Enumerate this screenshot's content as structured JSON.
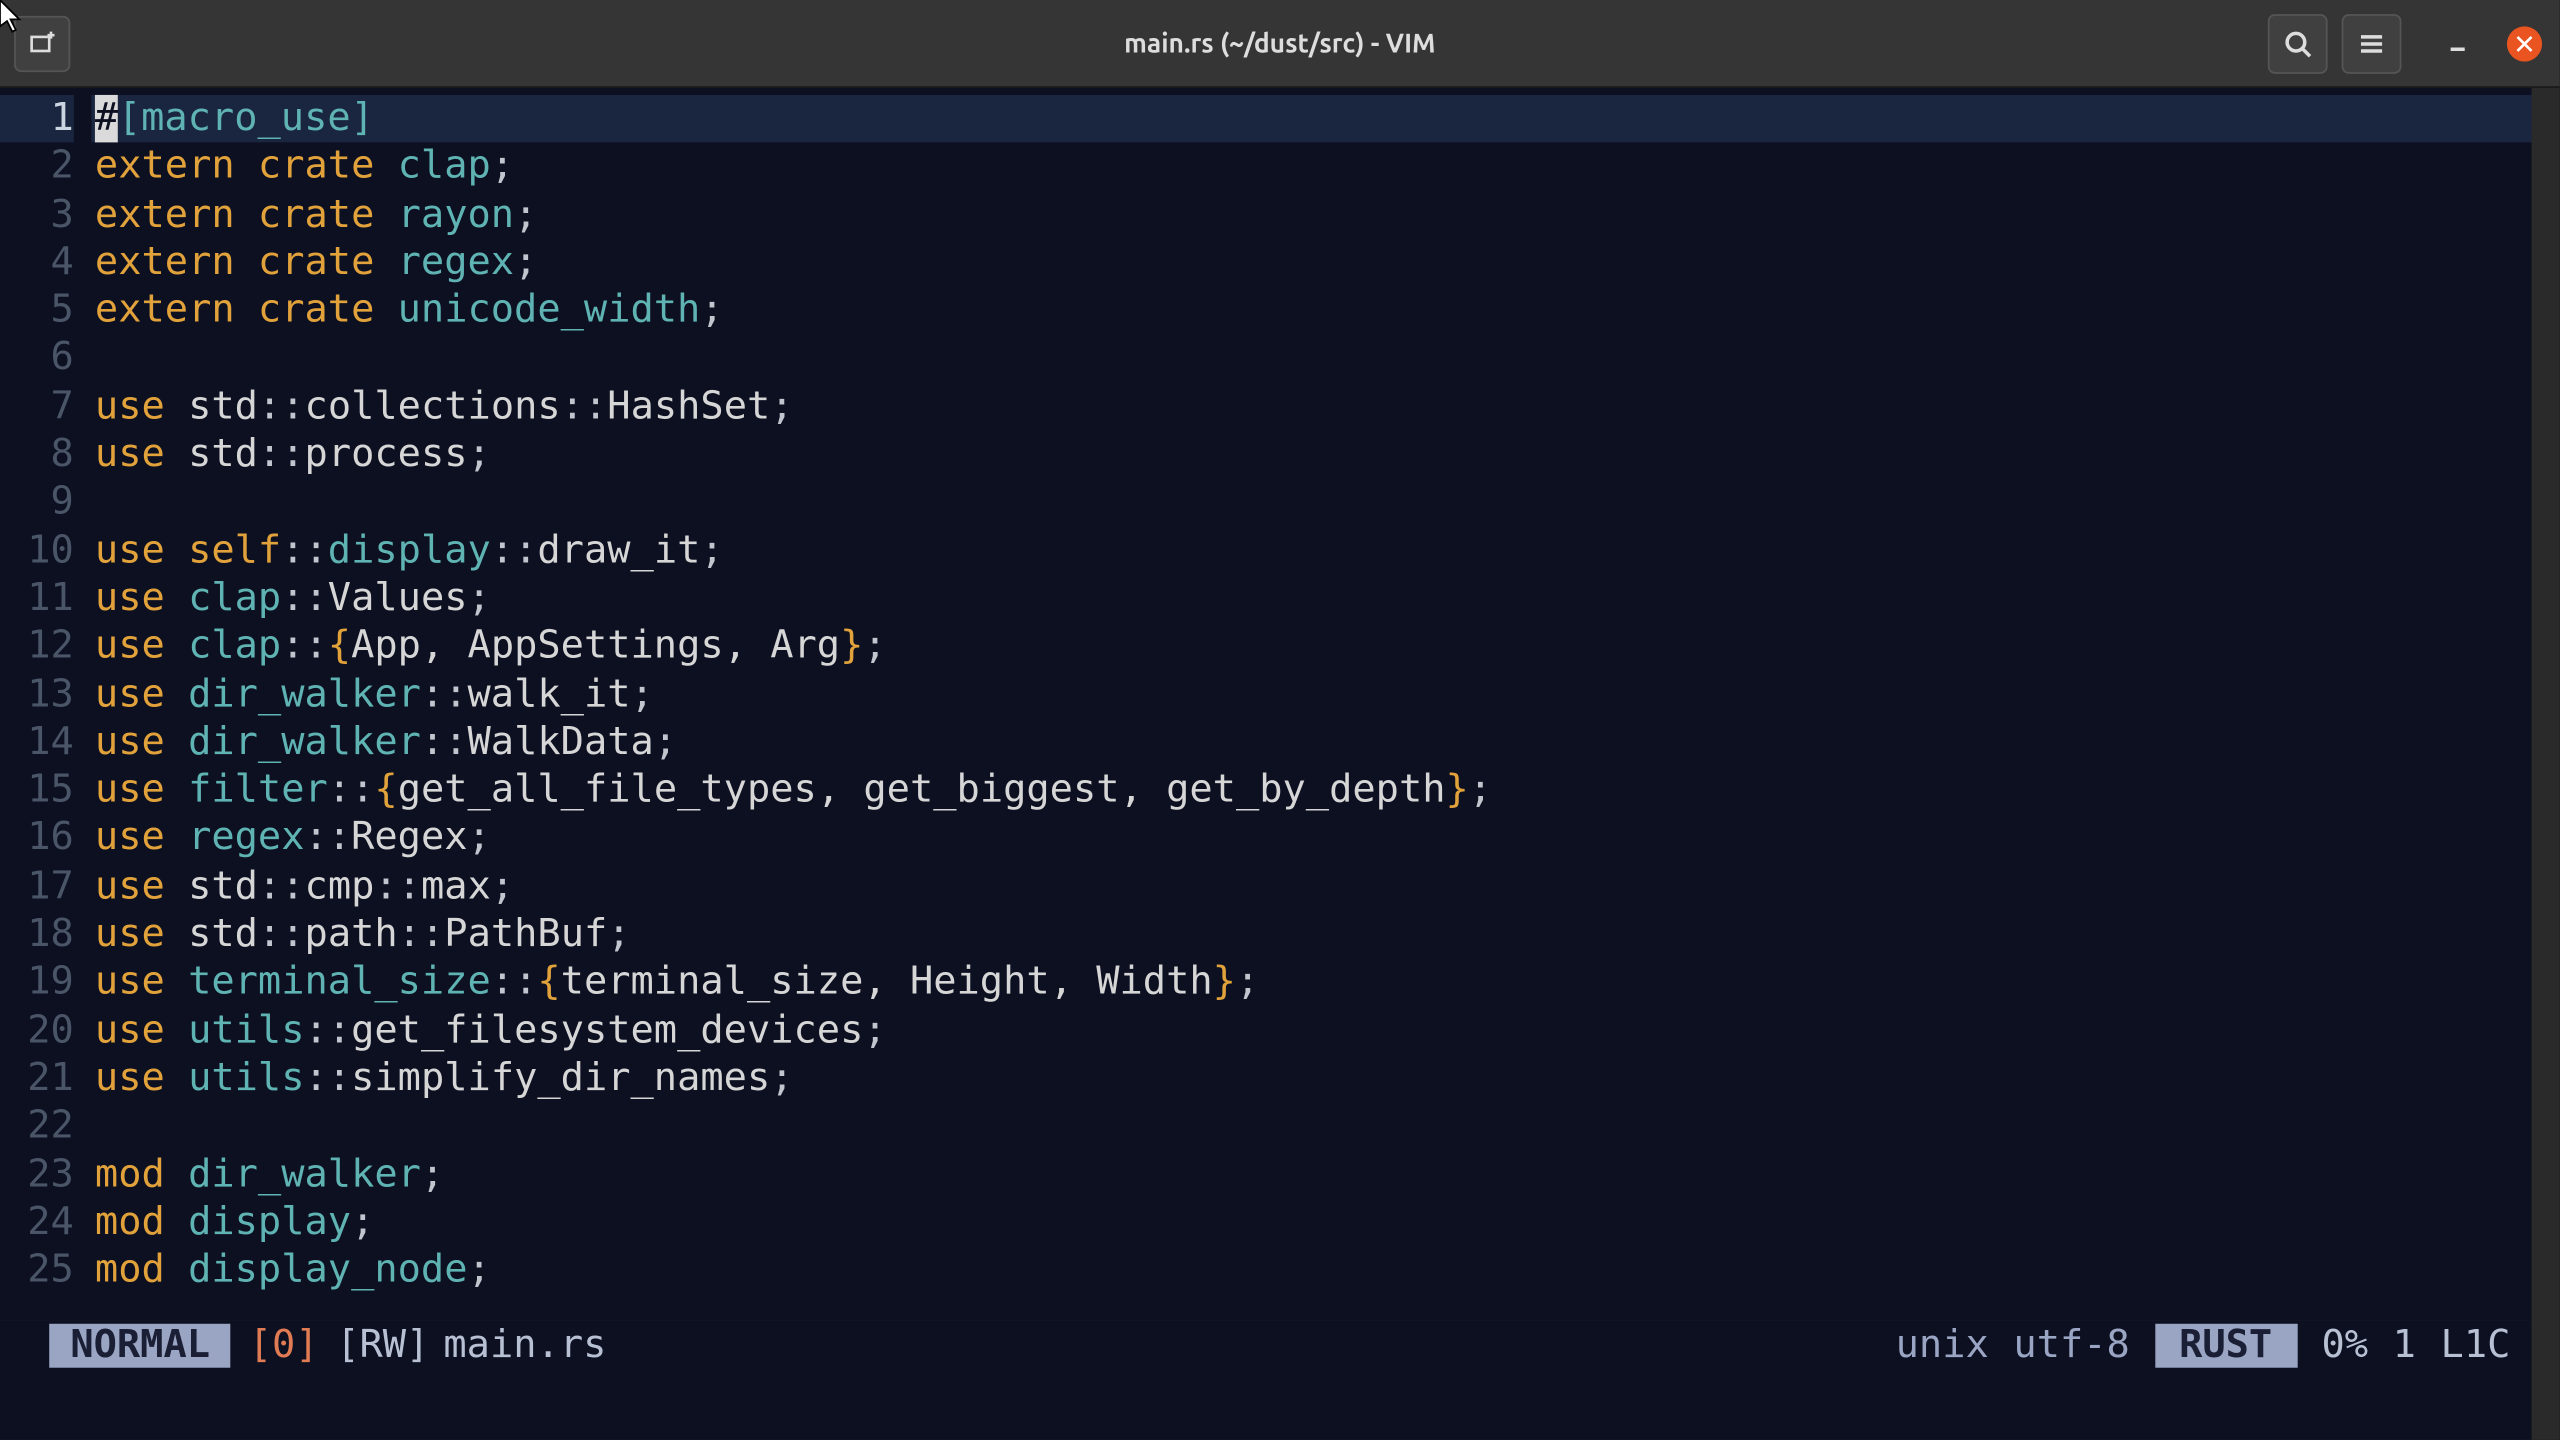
{
  "window": {
    "title": "main.rs (~/dust/src) - VIM"
  },
  "code": {
    "lines": [
      {
        "n": 1,
        "current": true,
        "tokens": [
          {
            "t": "#",
            "cursor": true
          },
          {
            "t": "[macro_use]",
            "c": "kw-teal"
          }
        ]
      },
      {
        "n": 2,
        "tokens": [
          {
            "t": "extern crate ",
            "c": "kw-orange"
          },
          {
            "t": "clap",
            "c": "kw-teal"
          },
          {
            "t": ";",
            "c": "punct"
          }
        ]
      },
      {
        "n": 3,
        "tokens": [
          {
            "t": "extern crate ",
            "c": "kw-orange"
          },
          {
            "t": "rayon",
            "c": "kw-teal"
          },
          {
            "t": ";",
            "c": "punct"
          }
        ]
      },
      {
        "n": 4,
        "tokens": [
          {
            "t": "extern crate ",
            "c": "kw-orange"
          },
          {
            "t": "regex",
            "c": "kw-teal"
          },
          {
            "t": ";",
            "c": "punct"
          }
        ]
      },
      {
        "n": 5,
        "tokens": [
          {
            "t": "extern crate ",
            "c": "kw-orange"
          },
          {
            "t": "unicode_width",
            "c": "kw-teal"
          },
          {
            "t": ";",
            "c": "punct"
          }
        ]
      },
      {
        "n": 6,
        "tokens": []
      },
      {
        "n": 7,
        "tokens": [
          {
            "t": "use ",
            "c": "kw-orange"
          },
          {
            "t": "std",
            "c": "ident"
          },
          {
            "t": "::",
            "c": "punct"
          },
          {
            "t": "collections",
            "c": "ident"
          },
          {
            "t": "::",
            "c": "punct"
          },
          {
            "t": "HashSet",
            "c": "ident"
          },
          {
            "t": ";",
            "c": "punct"
          }
        ]
      },
      {
        "n": 8,
        "tokens": [
          {
            "t": "use ",
            "c": "kw-orange"
          },
          {
            "t": "std",
            "c": "ident"
          },
          {
            "t": "::",
            "c": "punct"
          },
          {
            "t": "process",
            "c": "ident"
          },
          {
            "t": ";",
            "c": "punct"
          }
        ]
      },
      {
        "n": 9,
        "tokens": []
      },
      {
        "n": 10,
        "tokens": [
          {
            "t": "use ",
            "c": "kw-orange"
          },
          {
            "t": "self",
            "c": "kw-orange"
          },
          {
            "t": "::",
            "c": "punct"
          },
          {
            "t": "display",
            "c": "kw-teal"
          },
          {
            "t": "::",
            "c": "punct"
          },
          {
            "t": "draw_it",
            "c": "ident"
          },
          {
            "t": ";",
            "c": "punct"
          }
        ]
      },
      {
        "n": 11,
        "tokens": [
          {
            "t": "use ",
            "c": "kw-orange"
          },
          {
            "t": "clap",
            "c": "kw-teal"
          },
          {
            "t": "::",
            "c": "punct"
          },
          {
            "t": "Values",
            "c": "ident"
          },
          {
            "t": ";",
            "c": "punct"
          }
        ]
      },
      {
        "n": 12,
        "tokens": [
          {
            "t": "use ",
            "c": "kw-orange"
          },
          {
            "t": "clap",
            "c": "kw-teal"
          },
          {
            "t": "::",
            "c": "punct"
          },
          {
            "t": "{",
            "c": "brace"
          },
          {
            "t": "App, AppSettings, Arg",
            "c": "ident"
          },
          {
            "t": "}",
            "c": "brace"
          },
          {
            "t": ";",
            "c": "punct"
          }
        ]
      },
      {
        "n": 13,
        "tokens": [
          {
            "t": "use ",
            "c": "kw-orange"
          },
          {
            "t": "dir_walker",
            "c": "kw-teal"
          },
          {
            "t": "::",
            "c": "punct"
          },
          {
            "t": "walk_it",
            "c": "ident"
          },
          {
            "t": ";",
            "c": "punct"
          }
        ]
      },
      {
        "n": 14,
        "tokens": [
          {
            "t": "use ",
            "c": "kw-orange"
          },
          {
            "t": "dir_walker",
            "c": "kw-teal"
          },
          {
            "t": "::",
            "c": "punct"
          },
          {
            "t": "WalkData",
            "c": "ident"
          },
          {
            "t": ";",
            "c": "punct"
          }
        ]
      },
      {
        "n": 15,
        "tokens": [
          {
            "t": "use ",
            "c": "kw-orange"
          },
          {
            "t": "filter",
            "c": "kw-teal"
          },
          {
            "t": "::",
            "c": "punct"
          },
          {
            "t": "{",
            "c": "brace"
          },
          {
            "t": "get_all_file_types, get_biggest, get_by_depth",
            "c": "ident"
          },
          {
            "t": "}",
            "c": "brace"
          },
          {
            "t": ";",
            "c": "punct"
          }
        ]
      },
      {
        "n": 16,
        "tokens": [
          {
            "t": "use ",
            "c": "kw-orange"
          },
          {
            "t": "regex",
            "c": "kw-teal"
          },
          {
            "t": "::",
            "c": "punct"
          },
          {
            "t": "Regex",
            "c": "ident"
          },
          {
            "t": ";",
            "c": "punct"
          }
        ]
      },
      {
        "n": 17,
        "tokens": [
          {
            "t": "use ",
            "c": "kw-orange"
          },
          {
            "t": "std",
            "c": "ident"
          },
          {
            "t": "::",
            "c": "punct"
          },
          {
            "t": "cmp",
            "c": "ident"
          },
          {
            "t": "::",
            "c": "punct"
          },
          {
            "t": "max",
            "c": "ident"
          },
          {
            "t": ";",
            "c": "punct"
          }
        ]
      },
      {
        "n": 18,
        "tokens": [
          {
            "t": "use ",
            "c": "kw-orange"
          },
          {
            "t": "std",
            "c": "ident"
          },
          {
            "t": "::",
            "c": "punct"
          },
          {
            "t": "path",
            "c": "ident"
          },
          {
            "t": "::",
            "c": "punct"
          },
          {
            "t": "PathBuf",
            "c": "ident"
          },
          {
            "t": ";",
            "c": "punct"
          }
        ]
      },
      {
        "n": 19,
        "tokens": [
          {
            "t": "use ",
            "c": "kw-orange"
          },
          {
            "t": "terminal_size",
            "c": "kw-teal"
          },
          {
            "t": "::",
            "c": "punct"
          },
          {
            "t": "{",
            "c": "brace"
          },
          {
            "t": "terminal_size, Height, Width",
            "c": "ident"
          },
          {
            "t": "}",
            "c": "brace"
          },
          {
            "t": ";",
            "c": "punct"
          }
        ]
      },
      {
        "n": 20,
        "tokens": [
          {
            "t": "use ",
            "c": "kw-orange"
          },
          {
            "t": "utils",
            "c": "kw-teal"
          },
          {
            "t": "::",
            "c": "punct"
          },
          {
            "t": "get_filesystem_devices",
            "c": "ident"
          },
          {
            "t": ";",
            "c": "punct"
          }
        ]
      },
      {
        "n": 21,
        "tokens": [
          {
            "t": "use ",
            "c": "kw-orange"
          },
          {
            "t": "utils",
            "c": "kw-teal"
          },
          {
            "t": "::",
            "c": "punct"
          },
          {
            "t": "simplify_dir_names",
            "c": "ident"
          },
          {
            "t": ";",
            "c": "punct"
          }
        ]
      },
      {
        "n": 22,
        "tokens": []
      },
      {
        "n": 23,
        "tokens": [
          {
            "t": "mod ",
            "c": "kw-orange"
          },
          {
            "t": "dir_walker",
            "c": "kw-teal"
          },
          {
            "t": ";",
            "c": "punct"
          }
        ]
      },
      {
        "n": 24,
        "tokens": [
          {
            "t": "mod ",
            "c": "kw-orange"
          },
          {
            "t": "display",
            "c": "kw-teal"
          },
          {
            "t": ";",
            "c": "punct"
          }
        ]
      },
      {
        "n": 25,
        "tokens": [
          {
            "t": "mod ",
            "c": "kw-orange"
          },
          {
            "t": "display_node",
            "c": "kw-teal"
          },
          {
            "t": ";",
            "c": "punct"
          }
        ]
      }
    ]
  },
  "status": {
    "mode": " NORMAL ",
    "zero": "[0]",
    "rw": "[RW]",
    "file": "main.rs",
    "unix": "unix",
    "encoding": "utf-8",
    "lang": " RUST ",
    "percent": "0%",
    "line": "1",
    "col": "L1C"
  }
}
